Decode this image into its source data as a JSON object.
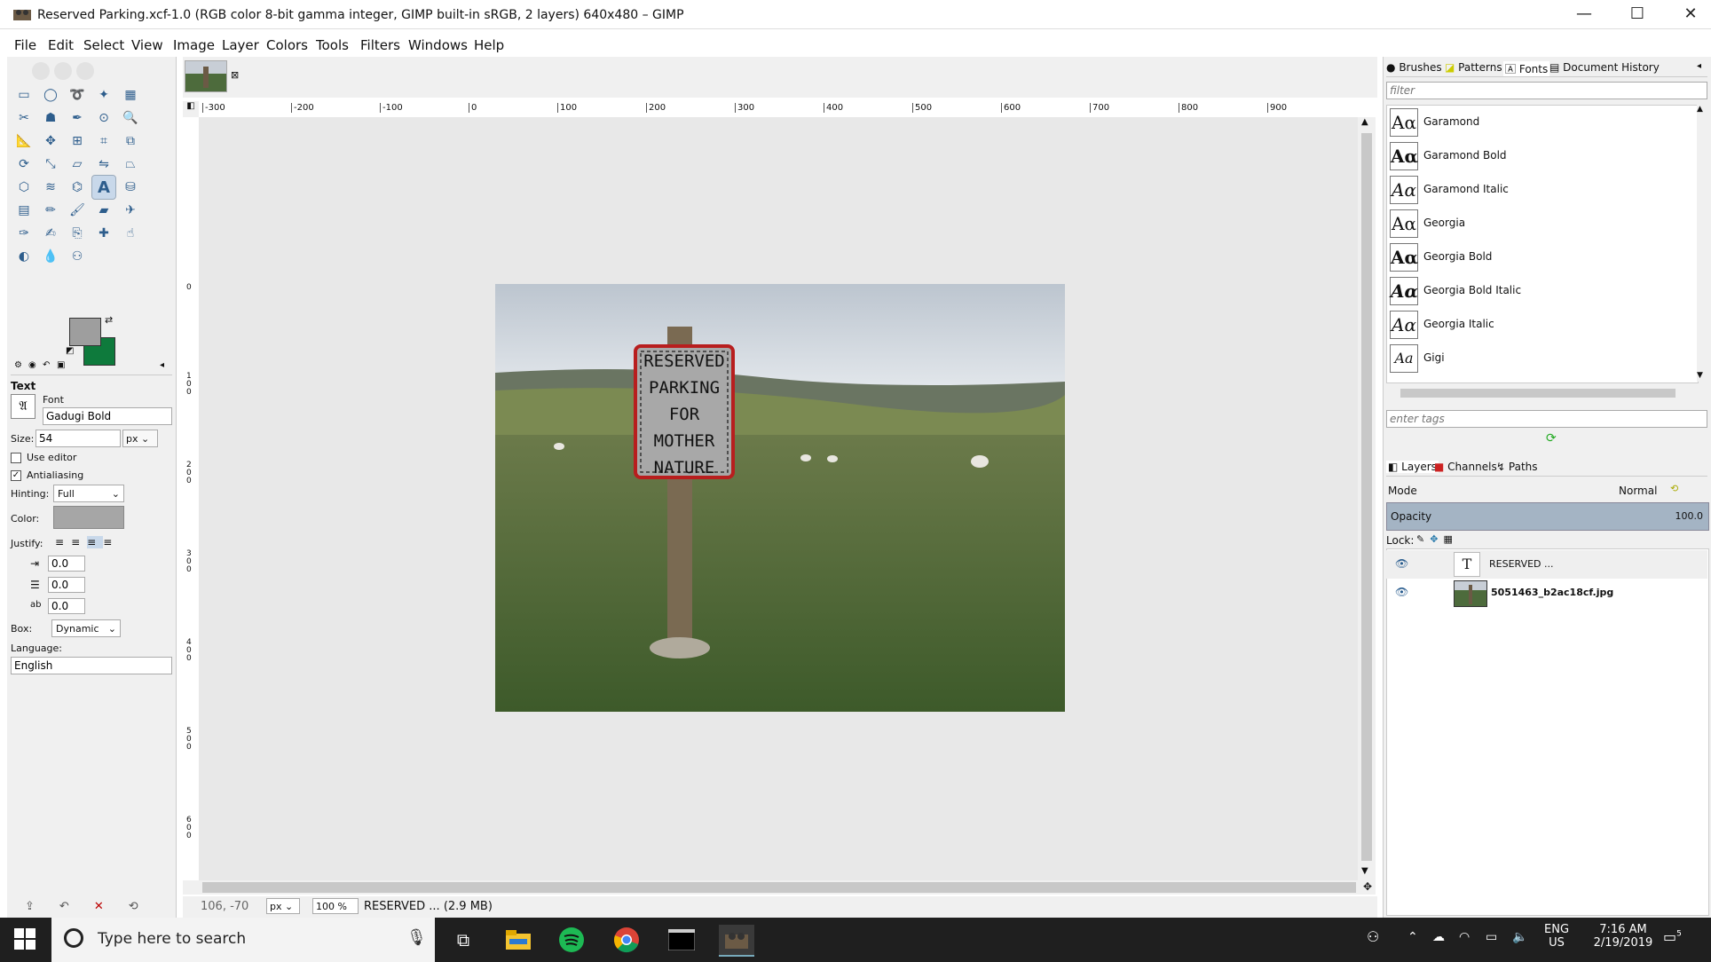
{
  "window": {
    "title": "Reserved Parking.xcf-1.0 (RGB color 8-bit gamma integer, GIMP built-in sRGB, 2 layers) 640x480 – GIMP",
    "minimize": "—",
    "maximize": "☐",
    "close": "✕"
  },
  "menu": [
    "File",
    "Edit",
    "Select",
    "View",
    "Image",
    "Layer",
    "Colors",
    "Tools",
    "Filters",
    "Windows",
    "Help"
  ],
  "toolbox": {
    "tools": [
      "rect-select",
      "ellipse-select",
      "free-select",
      "fuzzy-select",
      "by-color-select",
      "scissors-select",
      "foreground-select",
      "paths",
      "color-picker",
      "zoom",
      "measure",
      "move",
      "align",
      "crop",
      "unified-transform",
      "rotate",
      "scale",
      "shear",
      "flip",
      "perspective",
      "3d-transform",
      "warp-transform",
      "cage",
      "text",
      "bucket-fill",
      "gradient",
      "pencil",
      "paintbrush",
      "eraser",
      "airbrush",
      "ink",
      "mypaint-brush",
      "clone",
      "heal",
      "smudge",
      "dodge-burn",
      "blur",
      "perspective-clone"
    ],
    "active_tool": "text",
    "fg_color": "#9e9e9e",
    "bg_color": "#0e7a3c"
  },
  "tool_options": {
    "heading": "Text",
    "font_label": "Font",
    "font_value": "Gadugi Bold",
    "size_label": "Size:",
    "size_value": "54",
    "size_unit": "px",
    "use_editor_label": "Use editor",
    "antialiasing_label": "Antialiasing",
    "hinting_label": "Hinting:",
    "hinting_value": "Full",
    "color_label": "Color:",
    "color_value": "#a6a6a6",
    "justify_label": "Justify:",
    "indent_value": "0.0",
    "line_spacing_value": "0.0",
    "letter_spacing_value": "0.0",
    "box_label": "Box:",
    "box_value": "Dynamic",
    "language_label": "Language:",
    "language_value": "English"
  },
  "ruler": {
    "top_labels": [
      "-300",
      "-200",
      "-100",
      "0",
      "100",
      "200",
      "300",
      "400",
      "500",
      "600",
      "700",
      "800",
      "900"
    ],
    "left_labels": [
      "0",
      "1 0 0",
      "2 0 0",
      "3 0 0",
      "4 0 0",
      "5 0 0",
      "6 0 0"
    ]
  },
  "sign": {
    "lines": [
      "RESERVED",
      "PARKING",
      "FOR",
      "MOTHER",
      "NATURE"
    ]
  },
  "status": {
    "coords": "106, -70",
    "unit": "px",
    "zoom": "100 %",
    "message": "RESERVED ... (2.9 MB)"
  },
  "dock": {
    "tabs": [
      "Brushes",
      "Patterns",
      "Fonts",
      "Document History"
    ],
    "filter_placeholder": "filter",
    "fonts": [
      "Garamond",
      "Garamond Bold",
      "Garamond Italic",
      "Georgia",
      "Georgia Bold",
      "Georgia Bold Italic",
      "Georgia Italic",
      "Gigi"
    ],
    "tags_placeholder": "enter tags",
    "layer_tabs": [
      "Layers",
      "Channels",
      "Paths"
    ],
    "mode_label": "Mode",
    "mode_value": "Normal",
    "opacity_label": "Opacity",
    "opacity_value": "100.0",
    "lock_label": "Lock:",
    "layers": [
      "RESERVED ...",
      "5051463_b2ac18cf.jpg"
    ]
  },
  "taskbar": {
    "search_placeholder": "Type here to search",
    "lang_top": "ENG",
    "lang_bottom": "US",
    "time": "7:16 AM",
    "date": "2/19/2019",
    "notification_count": "5"
  }
}
